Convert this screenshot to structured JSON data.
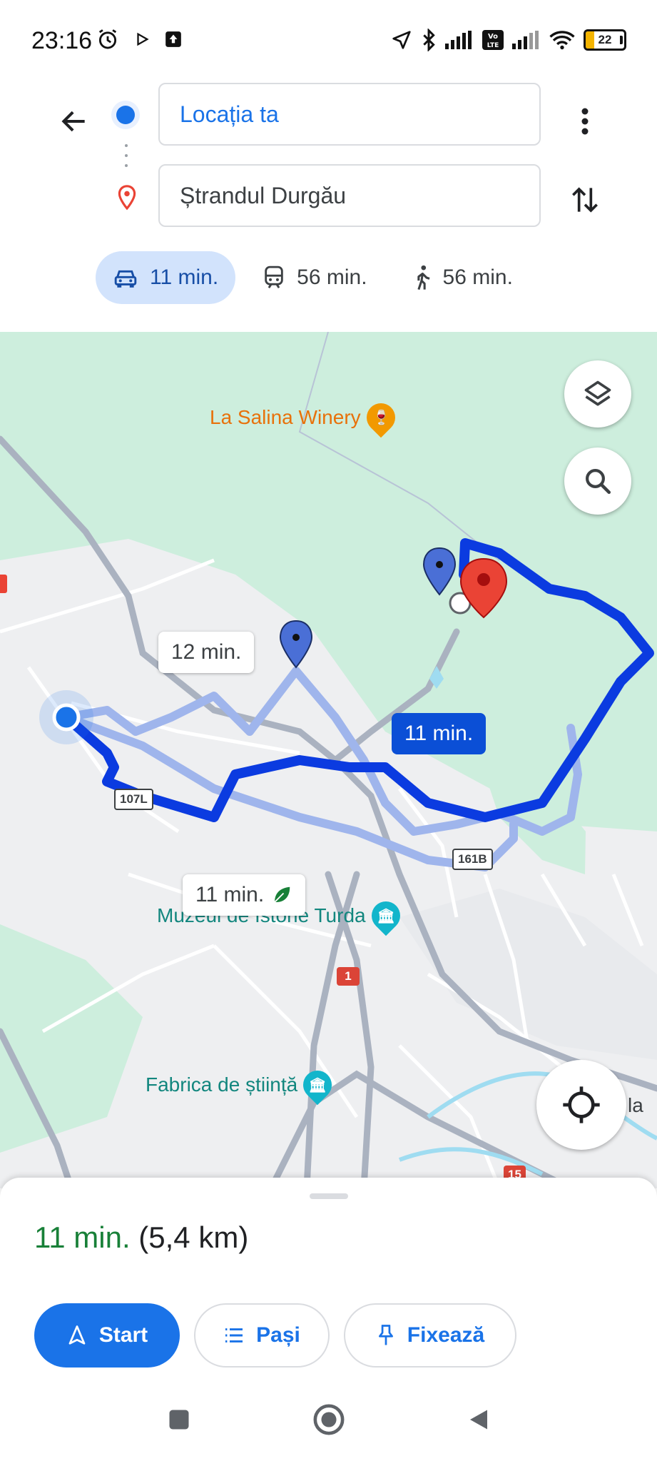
{
  "status_bar": {
    "time": "23:16",
    "battery_level": "22",
    "icons": [
      "alarm-icon",
      "play-icon",
      "upload-icon",
      "location-arrow-icon",
      "bluetooth-icon",
      "signal-icon",
      "volte-icon",
      "signal-icon",
      "wifi-icon",
      "battery-icon"
    ]
  },
  "directions": {
    "origin": "Locația ta",
    "destination": "Ștrandul Durgău",
    "modes": [
      {
        "icon": "car-icon",
        "label": "11 min.",
        "active": true
      },
      {
        "icon": "train-icon",
        "label": "56 min.",
        "active": false
      },
      {
        "icon": "walk-icon",
        "label": "56 min.",
        "active": false
      }
    ]
  },
  "map": {
    "pois": {
      "winery": "La Salina Winery",
      "museum": "Muzeul de Istorie Turda",
      "fabrica": "Fabrica de știință"
    },
    "route_labels": {
      "alt_route_1": "12 min.",
      "alt_route_2": "11 min.",
      "main_route": "11 min."
    },
    "road_shields": [
      "107L",
      "161B",
      "1",
      "15"
    ],
    "partial_label": "la",
    "colors": {
      "main_route": "#0b3be0",
      "alt_route": "#9fb5ec",
      "destination_pin": "#ea4335",
      "park": "#cdeedd"
    }
  },
  "summary": {
    "eta": "11 min.",
    "distance": "(5,4 km)"
  },
  "actions": {
    "start": "Start",
    "steps": "Pași",
    "pin": "Fixează"
  }
}
